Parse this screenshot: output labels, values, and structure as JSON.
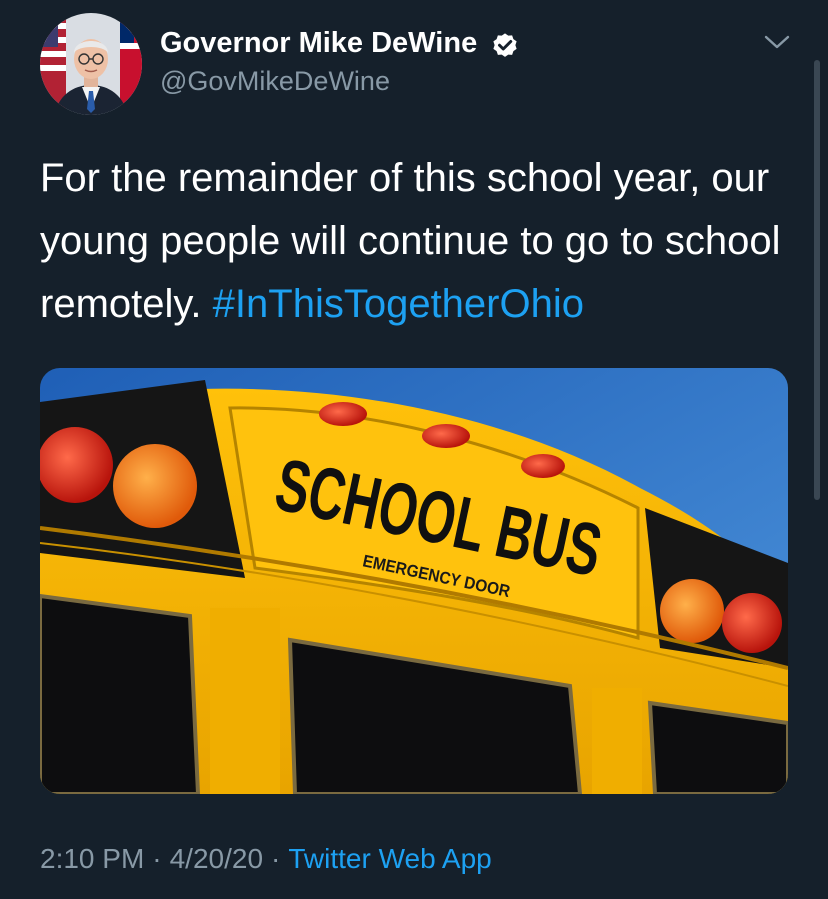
{
  "author": {
    "name": "Governor Mike DeWine",
    "handle": "@GovMikeDeWine",
    "verified": true
  },
  "tweet": {
    "text": "For the remainder of this school year, our young people will continue to go to school remotely.",
    "hashtag": "#InThisTogetherOhio"
  },
  "media": {
    "sign_text": "SCHOOL BUS",
    "sub_sign_text": "EMERGENCY DOOR"
  },
  "footer": {
    "time": "2:10 PM",
    "separator": "·",
    "date": "4/20/20",
    "source": "Twitter Web App"
  },
  "colors": {
    "background": "#15202b",
    "link": "#1da1f2",
    "secondary_text": "#8899a6",
    "bus_yellow": "#f5b400",
    "sky_blue": "#2f72c4"
  },
  "icons": {
    "verified": "verified-badge-icon",
    "caret": "chevron-down-icon"
  }
}
